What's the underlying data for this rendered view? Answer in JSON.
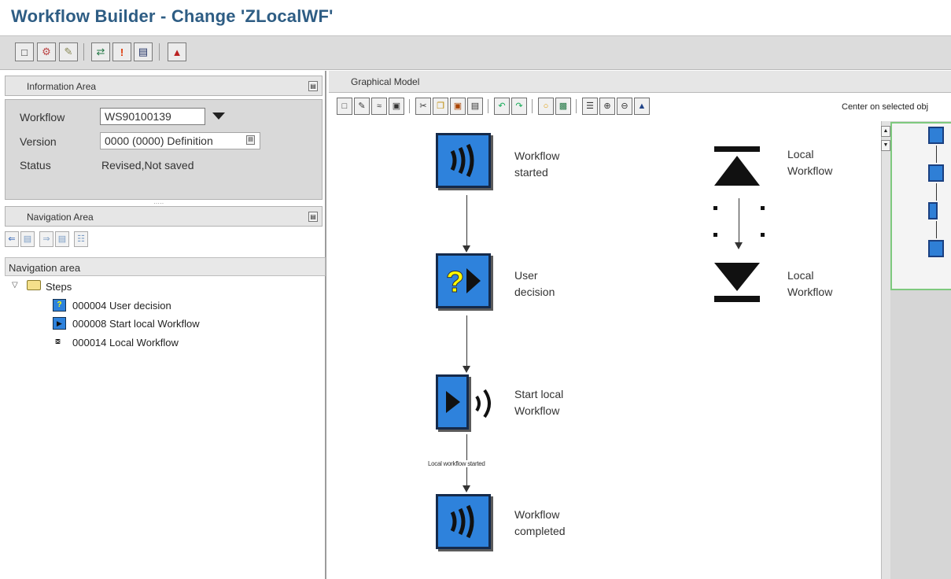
{
  "window": {
    "title": "Workflow Builder - Change 'ZLocalWF'"
  },
  "app_toolbar": {
    "icons": [
      "new-doc-icon",
      "properties-icon",
      "edit-icon",
      "binding-icon",
      "warning-icon",
      "display-icon",
      "wizard-icon"
    ]
  },
  "info_area": {
    "header": "Information Area",
    "workflow_label": "Workflow",
    "workflow_value": "WS90100139",
    "version_label": "Version",
    "version_value": "0000 (0000) Definition",
    "status_label": "Status",
    "status_value": "Revised,Not saved"
  },
  "nav_area": {
    "header": "Navigation Area",
    "tree_header": "Navigation area",
    "root": "Steps",
    "items": [
      {
        "icon": "user-decision-icon",
        "label": "000004 User decision"
      },
      {
        "icon": "start-local-workflow-icon",
        "label": "000008 Start local Workflow"
      },
      {
        "icon": "local-workflow-icon",
        "label": "000014 Local Workflow"
      }
    ]
  },
  "graphical_model": {
    "header": "Graphical Model",
    "center_button": "Center on selected obj"
  },
  "canvas": {
    "nodes": [
      {
        "icon": "workflow-started-icon",
        "label_line1": "Workflow",
        "label_line2": "started"
      },
      {
        "icon": "user-decision-icon",
        "label_line1": "User",
        "label_line2": "decision"
      },
      {
        "icon": "start-local-workflow-icon",
        "label_line1": "Start local",
        "label_line2": "Workflow"
      },
      {
        "icon": "workflow-completed-icon",
        "label_line1": "Workflow",
        "label_line2": "completed"
      }
    ],
    "edge_label": "Local workflow started",
    "local_workflow": {
      "label_line1": "Local",
      "label_line2": "Workflow"
    },
    "local_workflow_end": {
      "label_line1": "Local",
      "label_line2": "Workflow"
    }
  },
  "colors": {
    "title": "#2e5d84",
    "node_fill": "#2e82dc",
    "node_border": "#152a4a",
    "overview_frame": "#7ec97e"
  }
}
